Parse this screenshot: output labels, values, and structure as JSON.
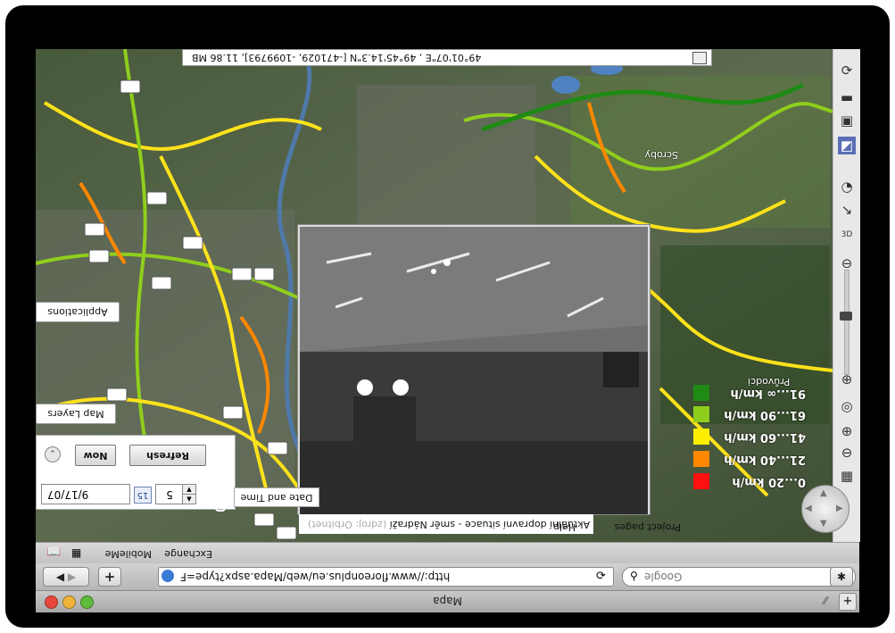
{
  "window": {
    "title": "Mapa"
  },
  "browser": {
    "url": "http://www.floreonplus.eu/web/Mapa.aspx?type=F",
    "search_placeholder": "Google",
    "bookmarks": [
      "MobileMe",
      "Exchange"
    ]
  },
  "map": {
    "coordinates": "49°01'07\"E , 49°45'14.3\"N [-471029, -1099793], 11.86 MB",
    "place_label": "Scroby",
    "applications_label": "Applications",
    "map_layers_label": "Map Layers",
    "nav_links": [
      "Help",
      "Project pages"
    ]
  },
  "legend": {
    "title": "Průvodci",
    "items": [
      {
        "label": "91...∞ km/h",
        "color": "#1f8a14"
      },
      {
        "label": "61...90 km/h",
        "color": "#8fce1c"
      },
      {
        "label": "41...60 km/h",
        "color": "#ffee00"
      },
      {
        "label": "21...40 km/h",
        "color": "#ff8800"
      },
      {
        "label": "0...20 km/h",
        "color": "#ff1111"
      }
    ]
  },
  "camera_popup": {
    "caption": "Aktuální dopravní situace - směr Nádraží",
    "source": "(zdroj: Orbitnet)"
  },
  "date_panel": {
    "date_value": "9/17/07",
    "calendar_label": "15",
    "interval_value": "5",
    "now_label": "Now",
    "refresh_label": "Refresh",
    "tab_label": "Date and Time"
  }
}
